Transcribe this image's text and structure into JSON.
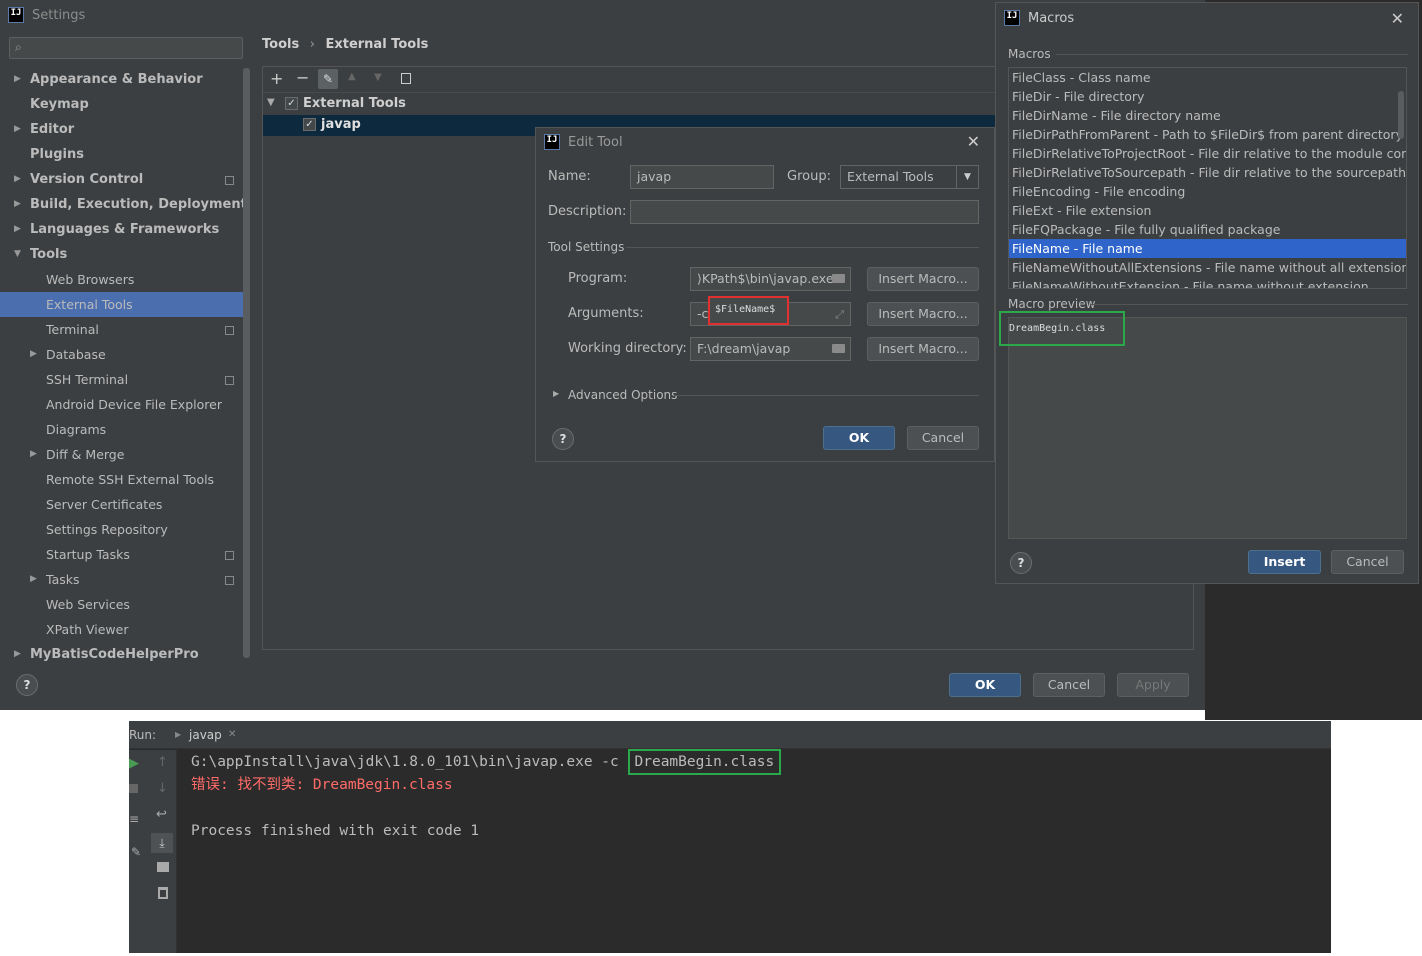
{
  "settings": {
    "title": "Settings",
    "breadcrumb": [
      "Tools",
      "External Tools"
    ],
    "tree": [
      {
        "label": "Appearance & Behavior",
        "level": 0,
        "bold": true,
        "arrow": "right"
      },
      {
        "label": "Keymap",
        "level": 0,
        "bold": true
      },
      {
        "label": "Editor",
        "level": 0,
        "bold": true,
        "arrow": "right"
      },
      {
        "label": "Plugins",
        "level": 0,
        "bold": true
      },
      {
        "label": "Version Control",
        "level": 0,
        "bold": true,
        "arrow": "right",
        "copy": true
      },
      {
        "label": "Build, Execution, Deployment",
        "level": 0,
        "bold": true,
        "arrow": "right"
      },
      {
        "label": "Languages & Frameworks",
        "level": 0,
        "bold": true,
        "arrow": "right"
      },
      {
        "label": "Tools",
        "level": 0,
        "bold": true,
        "arrow": "down"
      },
      {
        "label": "Web Browsers",
        "level": 1
      },
      {
        "label": "External Tools",
        "level": 1,
        "selected": true
      },
      {
        "label": "Terminal",
        "level": 1,
        "copy": true
      },
      {
        "label": "Database",
        "level": 1,
        "arrow": "right"
      },
      {
        "label": "SSH Terminal",
        "level": 1,
        "copy": true
      },
      {
        "label": "Android Device File Explorer",
        "level": 1
      },
      {
        "label": "Diagrams",
        "level": 1
      },
      {
        "label": "Diff & Merge",
        "level": 1,
        "arrow": "right"
      },
      {
        "label": "Remote SSH External Tools",
        "level": 1
      },
      {
        "label": "Server Certificates",
        "level": 1
      },
      {
        "label": "Settings Repository",
        "level": 1
      },
      {
        "label": "Startup Tasks",
        "level": 1,
        "copy": true
      },
      {
        "label": "Tasks",
        "level": 1,
        "arrow": "right",
        "copy": true
      },
      {
        "label": "Web Services",
        "level": 1
      },
      {
        "label": "XPath Viewer",
        "level": 1
      },
      {
        "label": "MyBatisCodeHelperPro",
        "level": 0,
        "bold": true,
        "arrow": "right"
      }
    ],
    "tools_tree": {
      "group": "External Tools",
      "item": "javap"
    },
    "buttons": {
      "ok": "OK",
      "cancel": "Cancel",
      "apply": "Apply"
    }
  },
  "edit_tool": {
    "title": "Edit Tool",
    "name_label": "Name:",
    "name_value": "javap",
    "group_label": "Group:",
    "group_value": "External Tools",
    "description_label": "Description:",
    "description_value": "",
    "tool_settings": "Tool Settings",
    "program_label": "Program:",
    "program_value": "⟩KPath$\\bin\\javap.exe",
    "arguments_label": "Arguments:",
    "arguments_prefix": "-c",
    "arguments_value": "$FileName$",
    "workdir_label": "Working directory:",
    "workdir_value": "F:\\dream\\javap",
    "insert_macro": "Insert Macro...",
    "advanced": "Advanced Options",
    "ok": "OK",
    "cancel": "Cancel"
  },
  "macros": {
    "title": "Macros",
    "section": "Macros",
    "items": [
      {
        "text": "FileClass - Class name"
      },
      {
        "text": "FileDir - File directory"
      },
      {
        "text": "FileDirName - File directory name"
      },
      {
        "text": "FileDirPathFromParent - Path to $FileDir$ from parent directory with"
      },
      {
        "text": "FileDirRelativeToProjectRoot - File dir relative to the module content"
      },
      {
        "text": "FileDirRelativeToSourcepath - File dir relative to the sourcepath root"
      },
      {
        "text": "FileEncoding - File encoding"
      },
      {
        "text": "FileExt - File extension"
      },
      {
        "text": "FileFQPackage - File fully qualified package"
      },
      {
        "text": "FileName - File name",
        "selected": true
      },
      {
        "text": "FileNameWithoutAllExtensions - File name without all extensions"
      },
      {
        "text": "FileNameWithoutExtension - File name without extension"
      }
    ],
    "preview_label": "Macro preview",
    "preview_value": "DreamBegin.class",
    "insert": "Insert",
    "cancel": "Cancel"
  },
  "run": {
    "label": "Run:",
    "tab": "javap",
    "lines": [
      {
        "prefix": "G:\\appInstall\\java\\jdk\\1.8.0_101\\bin\\javap.exe -c ",
        "highlight": "DreamBegin.class",
        "color": "#bbbbbb"
      },
      {
        "prefix": "错误: 找不到类: DreamBegin.class",
        "color": "#ff6b68"
      },
      {
        "prefix": "",
        "color": "#bbbbbb"
      },
      {
        "prefix": "Process finished with exit code 1",
        "color": "#bbbbbb"
      }
    ]
  },
  "colors": {
    "bg": "#3c3f41",
    "selection": "#4b6eaf",
    "console_bg": "#2b2b2b",
    "annotation_red": "#e03030",
    "annotation_green": "#2aa84a"
  }
}
